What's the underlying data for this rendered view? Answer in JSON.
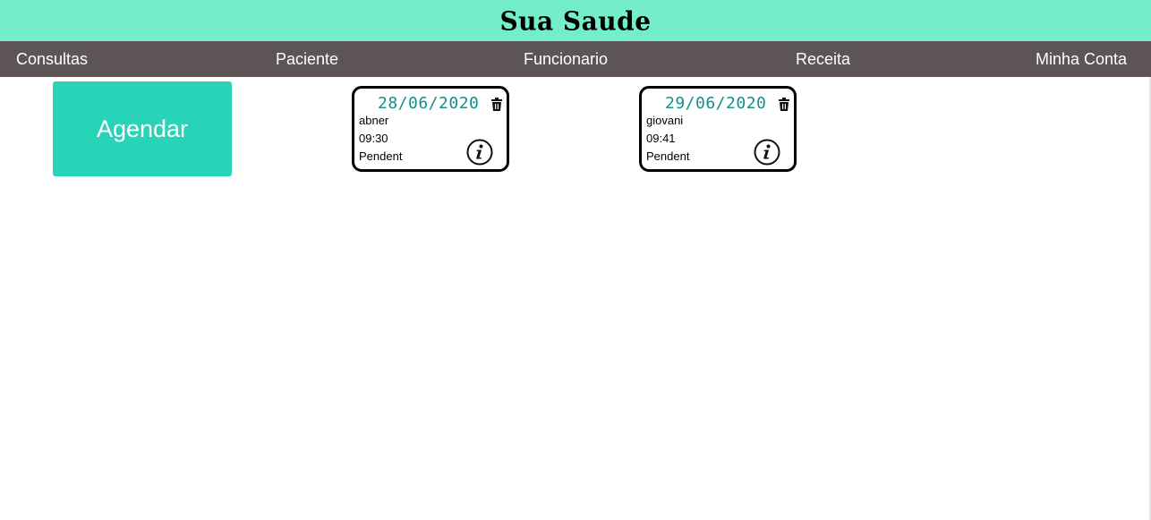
{
  "header": {
    "title": "Sua Saude",
    "color": "#73eec9"
  },
  "nav": {
    "color": "#5c5455",
    "items": [
      {
        "label": "Consultas"
      },
      {
        "label": "Paciente"
      },
      {
        "label": "Funcionario"
      },
      {
        "label": "Receita"
      },
      {
        "label": "Minha Conta"
      }
    ]
  },
  "actions": {
    "schedule_label": "Agendar",
    "schedule_color": "#29d3b7"
  },
  "appointments": [
    {
      "date": "28/06/2020",
      "name": "abner",
      "time": "09:30",
      "status": "Pendent"
    },
    {
      "date": "29/06/2020",
      "name": "giovani",
      "time": "09:41",
      "status": "Pendent"
    }
  ],
  "icons": {
    "delete": "trash-icon",
    "details": "info-icon"
  },
  "accent_colors": {
    "date": "#148e8e"
  }
}
